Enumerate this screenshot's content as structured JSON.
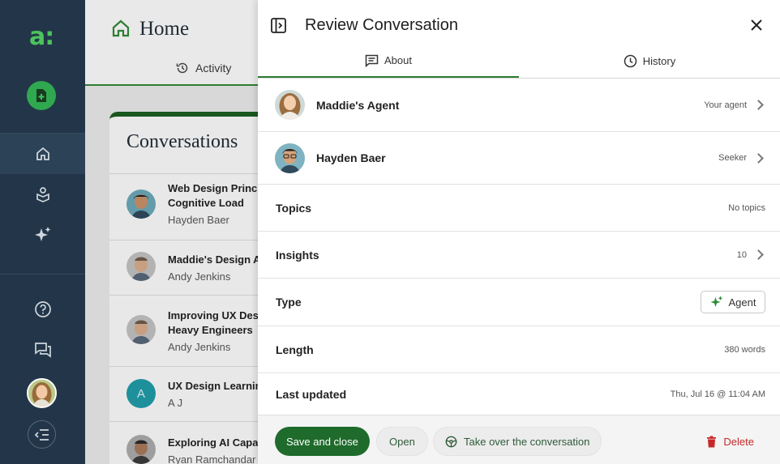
{
  "app": {
    "logo_text": "a:",
    "colors": {
      "sidebar": "#233649",
      "accent": "#2e7d32",
      "danger": "#c62828"
    }
  },
  "sidebar": {
    "items": [
      {
        "name": "new-conversation",
        "icon": "file-plus-icon"
      },
      {
        "name": "home",
        "icon": "home-icon",
        "active": true
      },
      {
        "name": "learning",
        "icon": "book-person-icon"
      },
      {
        "name": "ai",
        "icon": "sparkles-icon"
      },
      {
        "name": "help",
        "icon": "help-circle-icon"
      },
      {
        "name": "messages",
        "icon": "chat-icon"
      },
      {
        "name": "profile",
        "icon": "avatar"
      },
      {
        "name": "collapse",
        "icon": "menu-collapse-icon"
      }
    ]
  },
  "home": {
    "title": "Home",
    "tab_label": "Activity",
    "conversations_heading": "Conversations",
    "conversations": [
      {
        "title": "Web Design Principles",
        "title2": "Cognitive Load",
        "person": "Hayden Baer",
        "initial": ""
      },
      {
        "title": "Maddie's Design Agent",
        "title2": "",
        "person": "Andy Jenkins",
        "initial": ""
      },
      {
        "title": "Improving UX Design",
        "title2": "Heavy Engineers",
        "person": "Andy Jenkins",
        "initial": ""
      },
      {
        "title": "UX Design Learning",
        "title2": "",
        "person": "A J",
        "initial": "A"
      },
      {
        "title": "Exploring AI Capabilities",
        "title2": "",
        "person": "Ryan Ramchandar",
        "initial": ""
      }
    ]
  },
  "drawer": {
    "title": "Review Conversation",
    "tabs": [
      {
        "label": "About",
        "icon": "comment-icon",
        "active": true
      },
      {
        "label": "History",
        "icon": "clock-icon",
        "active": false
      }
    ],
    "participants": [
      {
        "name": "Maddie's Agent",
        "role": "Your agent"
      },
      {
        "name": "Hayden Baer",
        "role": "Seeker"
      }
    ],
    "details": {
      "topics_label": "Topics",
      "topics_value": "No topics",
      "insights_label": "Insights",
      "insights_value": "10",
      "type_label": "Type",
      "type_value": "Agent",
      "length_label": "Length",
      "length_value": "380 words",
      "updated_label": "Last updated",
      "updated_value": "Thu, Jul 16 @ 11:04 AM"
    },
    "footer": {
      "save_label": "Save and close",
      "open_label": "Open",
      "takeover_label": "Take over the conversation",
      "delete_label": "Delete"
    }
  }
}
